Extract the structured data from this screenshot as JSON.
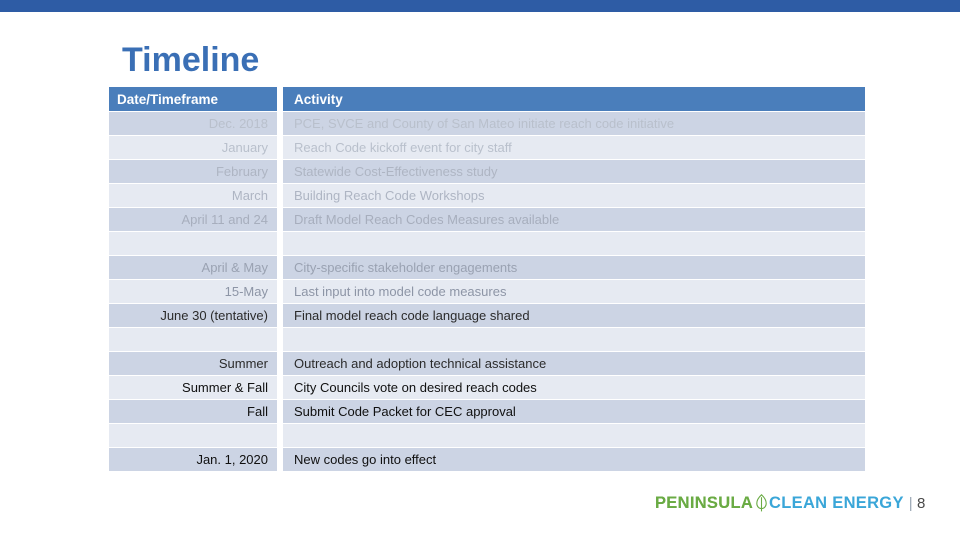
{
  "top_bar": {
    "color": "#2e5ca5"
  },
  "title": "Timeline",
  "table": {
    "columns": [
      "Date/Timeframe",
      "Activity"
    ],
    "header_bg": "#4a7ebb",
    "band_dark": "#ccd4e4",
    "band_light": "#e6eaf2",
    "rows": [
      {
        "date": "Dec. 2018",
        "activity": "PCE, SVCE and County of San Mateo initiate reach code initiative"
      },
      {
        "date": "January",
        "activity": "Reach Code kickoff event for city staff"
      },
      {
        "date": "February",
        "activity": "Statewide Cost-Effectiveness study"
      },
      {
        "date": "March",
        "activity": "Building Reach Code Workshops"
      },
      {
        "date": "April 11 and 24",
        "activity": "Draft Model Reach Codes Measures available"
      },
      {
        "date": "",
        "activity": ""
      },
      {
        "date": "April & May",
        "activity": "City-specific stakeholder engagements"
      },
      {
        "date": "15-May",
        "activity": "Last input into model code measures"
      },
      {
        "date": "June 30 (tentative)",
        "activity": "Final model reach code language shared"
      },
      {
        "date": "",
        "activity": ""
      },
      {
        "date": "Summer",
        "activity": "Outreach and adoption technical assistance"
      },
      {
        "date": "Summer & Fall",
        "activity": "City Councils vote on desired reach codes"
      },
      {
        "date": "Fall",
        "activity": "Submit Code Packet for CEC approval"
      },
      {
        "date": "",
        "activity": ""
      },
      {
        "date": "Jan. 1, 2020",
        "activity": "New codes go into effect"
      }
    ]
  },
  "footer": {
    "logo_part_one": "PENINSULA",
    "logo_icon": "leaf-icon",
    "logo_part_two": "CLEAN ENERGY",
    "divider": "|",
    "slide_number": "8",
    "green": "#6aab44",
    "blue": "#3aa6d8"
  }
}
